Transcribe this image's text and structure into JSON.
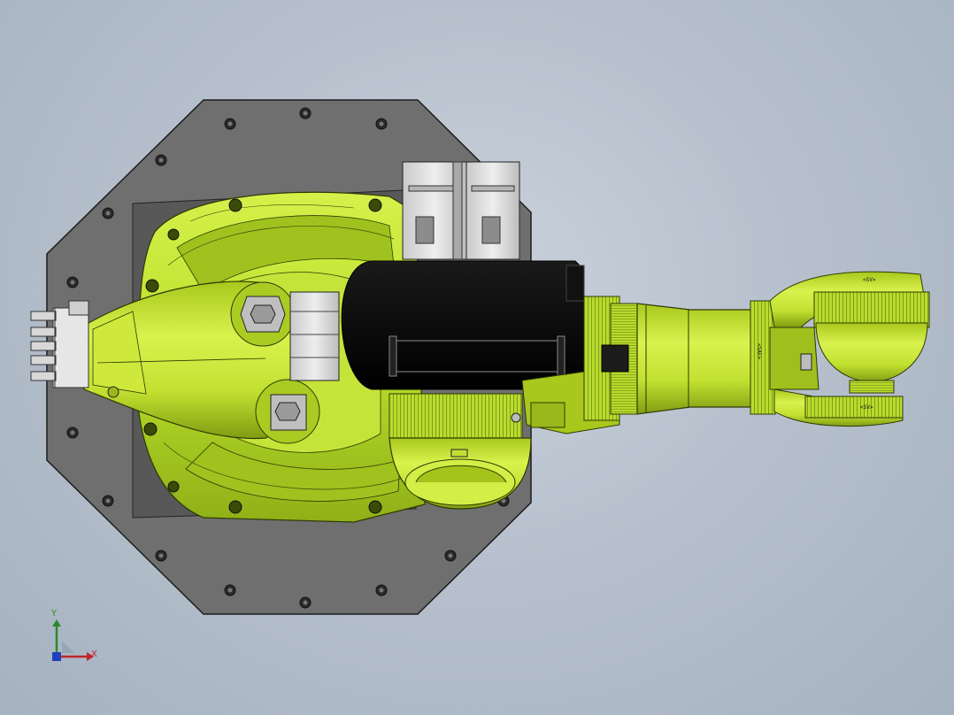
{
  "view": {
    "type": "cad-model-viewport",
    "background": "#b7c1cd"
  },
  "model": {
    "base_plate_color": "#6f6f6f",
    "body_color": "#b8e02a",
    "body_shade": "#7fa012",
    "motor_color": "#050505",
    "cover_color": "#d8d8d8"
  },
  "engravings": {
    "upper": "<SV>",
    "lower": "<SV>",
    "side": "<SAE>"
  },
  "triad": {
    "x_label": "X",
    "y_label": "Y",
    "x_color": "#c0262b",
    "y_color": "#2a8a2a",
    "z_color": "#2040c0"
  }
}
